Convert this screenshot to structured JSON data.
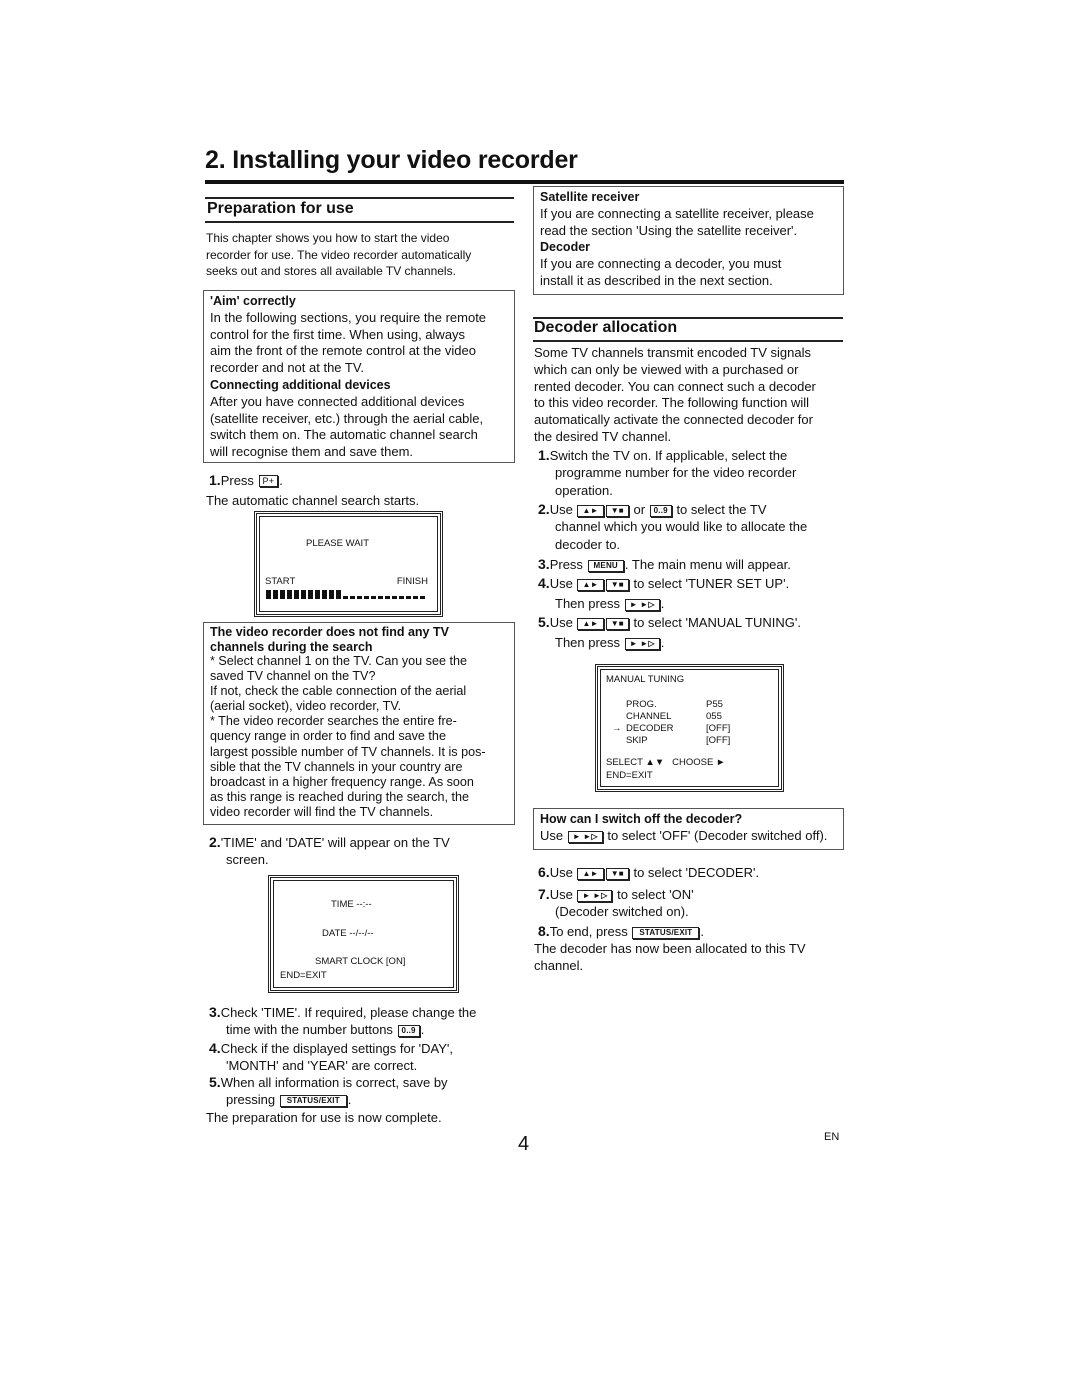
{
  "header": {
    "title": "2. Installing your video recorder"
  },
  "preparation": {
    "heading": "Preparation for use",
    "intro": [
      "This chapter shows you how to start the video",
      "recorder for use. The video recorder automatically",
      "seeks out and stores all available TV channels."
    ],
    "aim_box": {
      "heading1": "'Aim' correctly",
      "text1": [
        "In the following sections, you require the remote",
        "control for the first time. When using, always",
        "aim the front of the remote control at the video",
        "recorder and not at the TV."
      ],
      "heading2": "Connecting additional devices",
      "text2": [
        "After you have connected additional devices",
        "(satellite receiver, etc.) through the aerial cable,",
        "switch them on. The automatic channel search",
        "will recognise them and save them."
      ]
    },
    "step1": {
      "num": "1.",
      "pre": "Press",
      "key": "P+",
      "post": "."
    },
    "step1_after": "The automatic channel search starts.",
    "search_osd": {
      "line1": "PLEASE WAIT",
      "start_label": "START",
      "finish_label": "FINISH",
      "progress_filled": 11,
      "progress_total": 23
    },
    "not_found_box": {
      "heading": [
        "The video recorder does not find any TV",
        "channels during the search"
      ],
      "lines": [
        "* Select channel 1 on the TV. Can you see the",
        "saved TV channel on the TV?",
        "If not, check the cable connection of the aerial",
        "(aerial socket), video recorder, TV.",
        "* The video recorder searches the entire fre-",
        "quency range in order to find and save the",
        "largest possible number of TV channels. It is pos-",
        "sible that the TV channels in your country are",
        "broadcast in a higher frequency range. As soon",
        "as this range is reached during the search, the",
        "video recorder will find the TV channels."
      ]
    },
    "step2": {
      "num": "2.",
      "line1": "'TIME' and 'DATE' will appear on the TV",
      "line2": "screen."
    },
    "time_osd": {
      "time": "TIME --:--",
      "date": "DATE --/--/--",
      "smart_clock": "SMART CLOCK [ON]",
      "exit": "END=EXIT"
    },
    "step3": {
      "num": "3.",
      "line1": "Check 'TIME'. If required, please change the",
      "line2_pre": "time with the number buttons",
      "key": "0..9",
      "post": "."
    },
    "step4": {
      "num": "4.",
      "line1": "Check if the displayed settings for 'DAY',",
      "line2": "'MONTH' and 'YEAR' are correct."
    },
    "step5": {
      "num": "5.",
      "line1": "When all information is correct, save by",
      "line2_pre": "pressing",
      "key": "STATUS/EXIT",
      "post": "."
    },
    "complete": "The preparation for use is now complete."
  },
  "info_box": {
    "heading1": "Satellite receiver",
    "text1": [
      "If you are connecting a satellite receiver, please",
      "read the section 'Using the satellite receiver'."
    ],
    "heading2": "Decoder",
    "text2": [
      "If you are connecting a decoder, you must",
      "install it as described in the next section."
    ]
  },
  "decoder": {
    "heading": "Decoder allocation",
    "intro": [
      "Some TV channels transmit encoded TV signals",
      "which can only be viewed with a purchased or",
      "rented decoder. You can connect such a decoder",
      "to this video recorder. The following function will",
      "automatically activate the connected decoder for",
      "the desired TV channel."
    ],
    "step1": {
      "num": "1.",
      "lines": [
        "Switch the TV on. If applicable, select the",
        "programme number for the video recorder",
        "operation."
      ]
    },
    "step2": {
      "num": "2.",
      "pre": "Use",
      "key_up": "▲►",
      "key_down": "▼■",
      "or": "or",
      "key_num": "0..9",
      "post": "to select the TV",
      "lines": [
        "channel which you would like to allocate the",
        "decoder to."
      ]
    },
    "step3": {
      "num": "3.",
      "pre": "Press",
      "key": "MENU",
      "post": ". The main menu will appear."
    },
    "step4": {
      "num": "4.",
      "pre": "Use",
      "key_up": "▲►",
      "key_down": "▼■",
      "post": "to select 'TUNER SET UP'.",
      "then": "Then press",
      "key_fwd": "► ►▷",
      "end": "."
    },
    "step5": {
      "num": "5.",
      "pre": "Use",
      "key_up": "▲►",
      "key_down": "▼■",
      "post": "to select 'MANUAL TUNING'.",
      "then": "Then press",
      "key_fwd": "► ►▷",
      "end": "."
    },
    "tuning_osd": {
      "title": "MANUAL TUNING",
      "rows": [
        {
          "label": "PROG.",
          "value": "P55",
          "selected": false
        },
        {
          "label": "CHANNEL",
          "value": "055",
          "selected": false
        },
        {
          "label": "DECODER",
          "value": "[OFF]",
          "selected": true
        },
        {
          "label": "SKIP",
          "value": "[OFF]",
          "selected": false
        }
      ],
      "pointer": "→",
      "select_label": "SELECT ▲▼",
      "choose_label": "CHOOSE ►",
      "exit": "END=EXIT"
    },
    "switch_off_box": {
      "heading": "How can I switch off the decoder?",
      "pre": "Use",
      "key": "► ►▷",
      "post": "to select 'OFF' (Decoder switched off)."
    },
    "step6": {
      "num": "6.",
      "pre": "Use",
      "key_up": "▲►",
      "key_down": "▼■",
      "post": "to select 'DECODER'."
    },
    "step7": {
      "num": "7.",
      "pre": "Use",
      "key": "► ►▷",
      "post": "to select 'ON'",
      "line2": "(Decoder switched on)."
    },
    "step8": {
      "num": "8.",
      "pre": "To end, press",
      "key": "STATUS/EXIT",
      "post": "."
    },
    "final": [
      "The decoder has now been allocated to this TV",
      "channel."
    ]
  },
  "footer": {
    "page_number": "4",
    "language": "EN"
  }
}
